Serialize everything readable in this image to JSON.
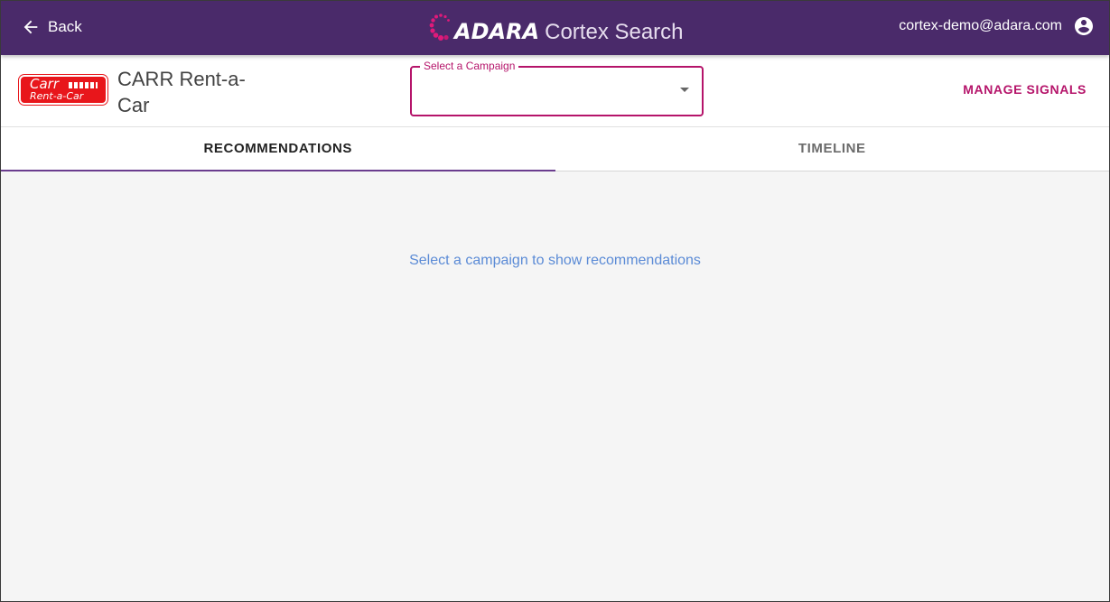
{
  "appbar": {
    "back_label": "Back",
    "brand_name": "ADARA",
    "product_name": "Cortex Search",
    "user_email": "cortex-demo@adara.com",
    "background_color": "#4a2a6a"
  },
  "header": {
    "client_logo": {
      "line1": "Carr",
      "line2": "Rent-a-Car"
    },
    "client_name": "CARR Rent-a-Car",
    "campaign_select": {
      "label": "Select a Campaign",
      "value": ""
    },
    "manage_signals_label": "MANAGE SIGNALS",
    "accent_color": "#b5146a"
  },
  "tabs": [
    {
      "label": "RECOMMENDATIONS",
      "active": true
    },
    {
      "label": "TIMELINE",
      "active": false
    }
  ],
  "main": {
    "empty_message": "Select a campaign to show recommendations"
  },
  "icons": {
    "back": "arrow-left-icon",
    "brand": "adara-dots-logo-icon",
    "account": "account-circle-icon",
    "dropdown": "caret-down-icon"
  }
}
